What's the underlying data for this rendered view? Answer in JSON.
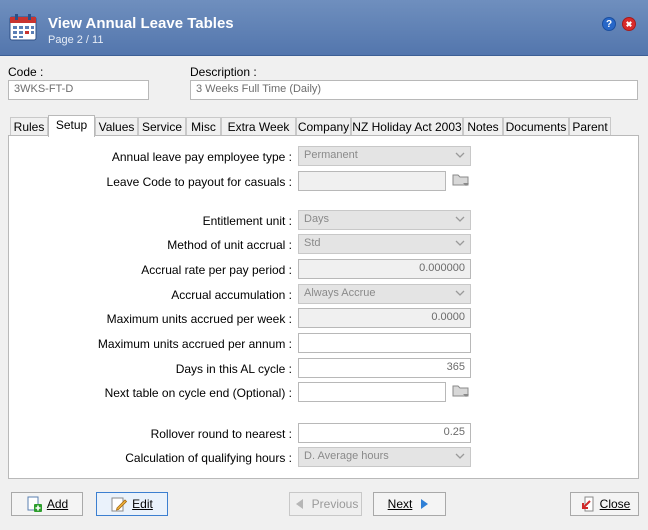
{
  "window": {
    "title": "View Annual Leave Tables",
    "subtitle": "Page 2 / 11",
    "help_glyph": "?",
    "close_glyph": "✖"
  },
  "header": {
    "code_label": "Code :",
    "code_value": "3WKS-FT-D",
    "description_label": "Description :",
    "description_value": "3 Weeks Full Time (Daily)"
  },
  "tabs": [
    {
      "label": "Rules"
    },
    {
      "label": "Setup",
      "active": true
    },
    {
      "label": "Values"
    },
    {
      "label": "Service"
    },
    {
      "label": "Misc"
    },
    {
      "label": "Extra Week"
    },
    {
      "label": "Company"
    },
    {
      "label": "NZ Holiday Act 2003"
    },
    {
      "label": "Notes"
    },
    {
      "label": "Documents"
    },
    {
      "label": "Parent"
    }
  ],
  "setup": {
    "pay_employee_type": {
      "label": "Annual leave pay employee type :",
      "value": "Permanent"
    },
    "leave_code_payout": {
      "label": "Leave Code to payout for casuals :",
      "value": ""
    },
    "entitlement_unit": {
      "label": "Entitlement unit :",
      "value": "Days"
    },
    "method_unit_accrual": {
      "label": "Method of unit accrual :",
      "value": "Std"
    },
    "accrual_rate": {
      "label": "Accrual rate per pay period :",
      "value": "0.000000"
    },
    "accrual_accumulation": {
      "label": "Accrual accumulation :",
      "value": "Always Accrue"
    },
    "max_units_week": {
      "label": "Maximum units accrued per week :",
      "value": "0.0000"
    },
    "max_units_annum": {
      "label": "Maximum units accrued per annum :",
      "value": ""
    },
    "days_al_cycle": {
      "label": "Days in this AL cycle :",
      "value": "365"
    },
    "next_table": {
      "label": "Next table on cycle end (Optional) :",
      "value": ""
    },
    "rollover": {
      "label": "Rollover round to nearest :",
      "value": "0.25"
    },
    "qualifying_hours": {
      "label": "Calculation of qualifying hours :",
      "value": "D. Average hours"
    }
  },
  "buttons": {
    "add": "Add",
    "edit": "Edit",
    "previous": "Previous",
    "next": "Next",
    "close": "Close"
  },
  "colors": {
    "title_bar": "#5a7db3",
    "help": "#2767c8",
    "close": "#d92b2b",
    "focus_border": "#3c7fd0"
  },
  "icons": {
    "app": "calendar-icon",
    "lookup": "folder-lookup-icon",
    "add": "add-document-icon",
    "edit": "pencil-icon",
    "previous": "arrow-left-icon",
    "next": "arrow-right-icon",
    "close": "exit-icon"
  }
}
